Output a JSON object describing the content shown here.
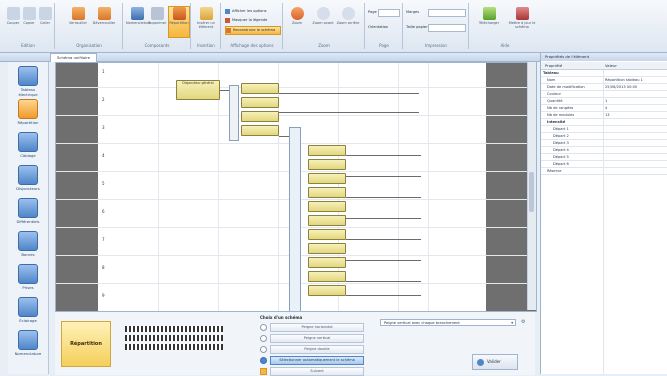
{
  "ribbon": {
    "groups": [
      {
        "label": "Edition",
        "buttons": [
          "Couper",
          "Copier",
          "Coller"
        ]
      },
      {
        "label": "Organisation",
        "buttons": [
          "Verrouiller",
          "Déverrouiller"
        ]
      },
      {
        "label": "Composants",
        "buttons": [
          "Nomenclature",
          "Supprimer",
          "Répartition"
        ]
      },
      {
        "label": "Insertion",
        "buttons": [
          "Insérer un élément"
        ]
      },
      {
        "label": "Affichage des options",
        "buttons": [
          "Afficher les options",
          "Masquer la légende",
          "Reconstruire le schéma"
        ]
      },
      {
        "label": "Zoom",
        "buttons": [
          "Zoom",
          "Zoom avant",
          "Zoom arrière"
        ]
      },
      {
        "label": "Page",
        "buttons": [
          "Page",
          "Orientation"
        ]
      },
      {
        "label": "Impression",
        "buttons": [
          "Marges",
          "Taille papier"
        ]
      },
      {
        "label": "Aide",
        "buttons": [
          "Télécharger",
          "Mettre à jour le schéma"
        ]
      }
    ]
  },
  "titlebar": {
    "title": "Schéma unifilaire"
  },
  "sidebar": {
    "items": [
      {
        "label": "Tableau électrique"
      },
      {
        "label": "Répartition"
      },
      {
        "label": "Câblage"
      },
      {
        "label": "Disjoncteurs"
      },
      {
        "label": "Différentiels"
      },
      {
        "label": "Bornes"
      },
      {
        "label": "Prises"
      },
      {
        "label": "Éclairage"
      },
      {
        "label": "Nomenclature"
      }
    ]
  },
  "canvas": {
    "rows": [
      "1",
      "2",
      "3",
      "4",
      "5",
      "6",
      "7",
      "8",
      "9",
      "10"
    ],
    "main_node": "Disjoncteur général"
  },
  "bottom": {
    "preview_label": "Répartition",
    "options_title": "Choix d'un schéma",
    "options": [
      "Peigne horizontal",
      "Peigne vertical",
      "Peigne double",
      "Sélectionner automatiquement le schéma"
    ],
    "ok_label": "Suivant",
    "dropdown_value": "Peigne vertical avec chaque branchement",
    "apply_label": "Valider"
  },
  "properties": {
    "header": "Propriétés de l'élément",
    "col_property": "Propriété",
    "col_value": "Valeur",
    "section": "Tableau",
    "rows": [
      {
        "k": "Nom",
        "v": "Répartition tableau 1"
      },
      {
        "k": "Date de modification",
        "v": "25/06/2013 00:00"
      },
      {
        "k": "Couleur",
        "v": ""
      },
      {
        "k": "Quantité",
        "v": "1"
      },
      {
        "k": "Nb de rangées",
        "v": "4"
      },
      {
        "k": "Nb de modules",
        "v": "13"
      },
      {
        "k": "Intensité",
        "v": ""
      },
      {
        "k": "Départ 1",
        "v": ""
      },
      {
        "k": "Départ 2",
        "v": ""
      },
      {
        "k": "Départ 3",
        "v": ""
      },
      {
        "k": "Départ 4",
        "v": ""
      },
      {
        "k": "Départ 5",
        "v": ""
      },
      {
        "k": "Départ 6",
        "v": ""
      },
      {
        "k": "Réserve",
        "v": ""
      }
    ]
  },
  "colors": {
    "accent": "#4f86c9",
    "node": "#e8dd8a",
    "ribbon": "#dde6f1"
  }
}
